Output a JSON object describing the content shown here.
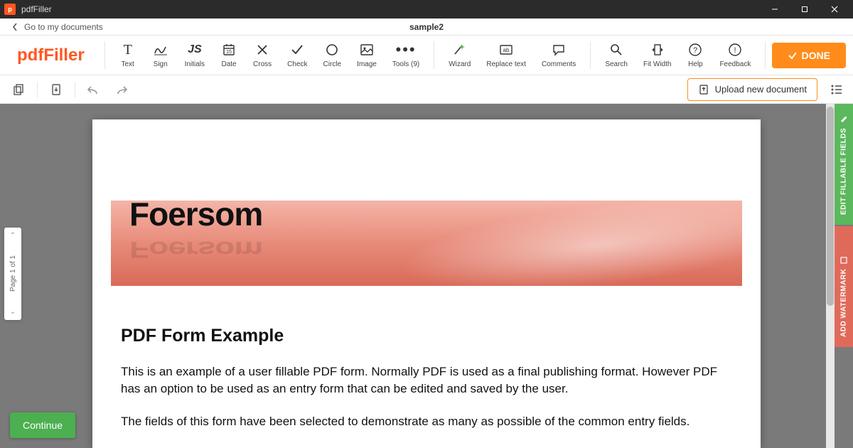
{
  "titlebar": {
    "app_name": "pdfFiller"
  },
  "breadcrumb": {
    "back_label": "Go to my documents",
    "doc_title": "sample2"
  },
  "logo": "pdfFiller",
  "tools": {
    "text": "Text",
    "sign": "Sign",
    "initials": "Initials",
    "date": "Date",
    "cross": "Cross",
    "check": "Check",
    "circle": "Circle",
    "image": "Image",
    "tools_dropdown": "Tools (9)",
    "wizard": "Wizard",
    "replace": "Replace text",
    "comments": "Comments",
    "search": "Search",
    "fit": "Fit Width",
    "help": "Help",
    "feedback": "Feedback"
  },
  "done_label": "DONE",
  "upload_label": "Upload new document",
  "page_nav": "Page 1 of 1",
  "side": {
    "edit": "EDIT FILLABLE FIELDS",
    "watermark": "ADD WATERMARK"
  },
  "continue_label": "Continue",
  "document": {
    "banner_title": "Foersom",
    "heading": "PDF Form Example",
    "para1": "This is an example of a user fillable PDF form. Normally PDF is used as a final publishing format. However PDF has an option to be used as an entry form that can be edited and saved by the user.",
    "para2": "The fields of this form have been selected to demonstrate as many as possible of the common entry fields."
  }
}
